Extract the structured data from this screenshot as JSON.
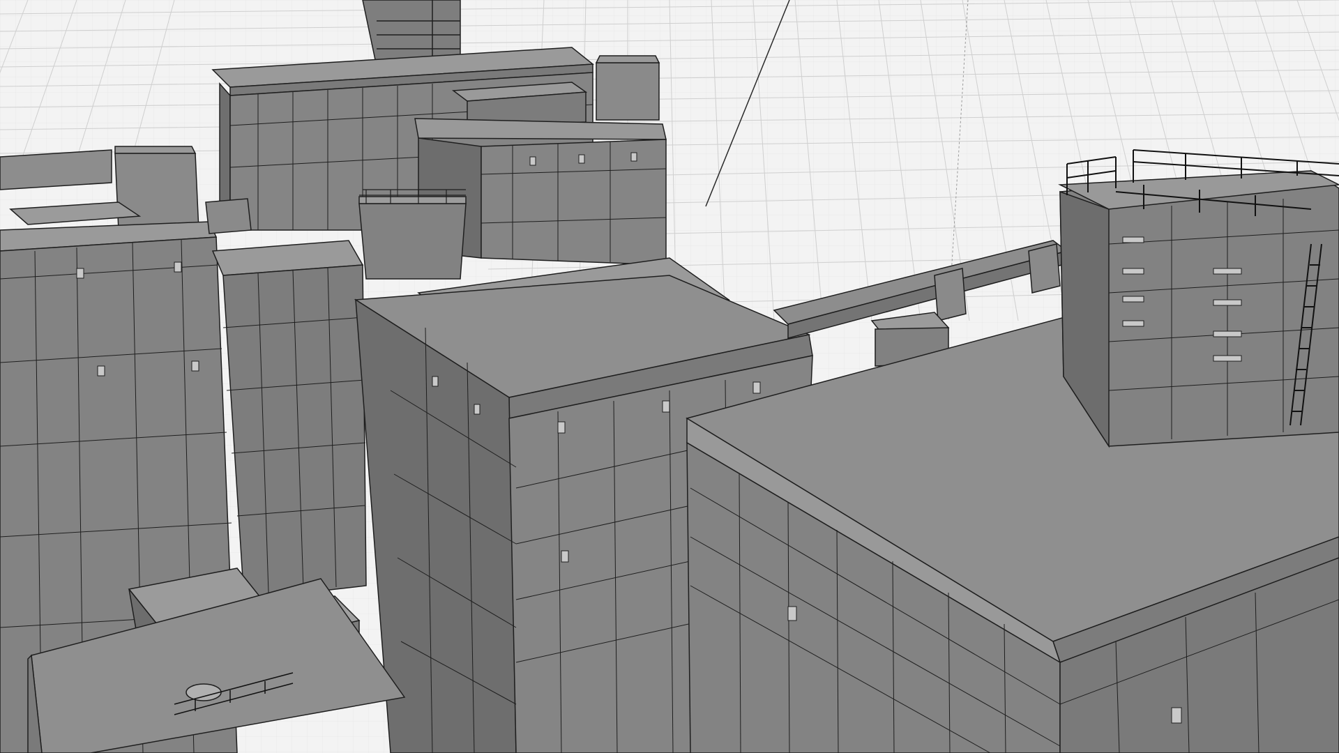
{
  "viewport": {
    "mode": "3d-perspective",
    "display": "shaded-with-wireframe",
    "visible_text": []
  },
  "scene": {
    "objects": [
      {
        "name": "building-far-left",
        "kind": "building"
      },
      {
        "name": "building-back-center",
        "kind": "building",
        "has_clock_tower": true
      },
      {
        "name": "building-back-right",
        "kind": "building"
      },
      {
        "name": "building-middle-left",
        "kind": "building"
      },
      {
        "name": "building-center-tall",
        "kind": "building"
      },
      {
        "name": "building-foreground-left",
        "kind": "building"
      },
      {
        "name": "building-front-right",
        "kind": "building",
        "has_rooftop_structure": true,
        "has_ladder": true,
        "has_railing": true
      },
      {
        "name": "rooftop-duct",
        "kind": "pipe"
      },
      {
        "name": "ground-grid",
        "kind": "grid"
      },
      {
        "name": "scene-axis",
        "kind": "axis"
      }
    ]
  },
  "colors": {
    "background": "#f3f3f3",
    "grid_line": "#d2d2d2",
    "roof_light": "#8e8e8e",
    "wall_light": "#808080",
    "wall_dark": "#6c6c6c",
    "edge": "#1e1e1e"
  }
}
